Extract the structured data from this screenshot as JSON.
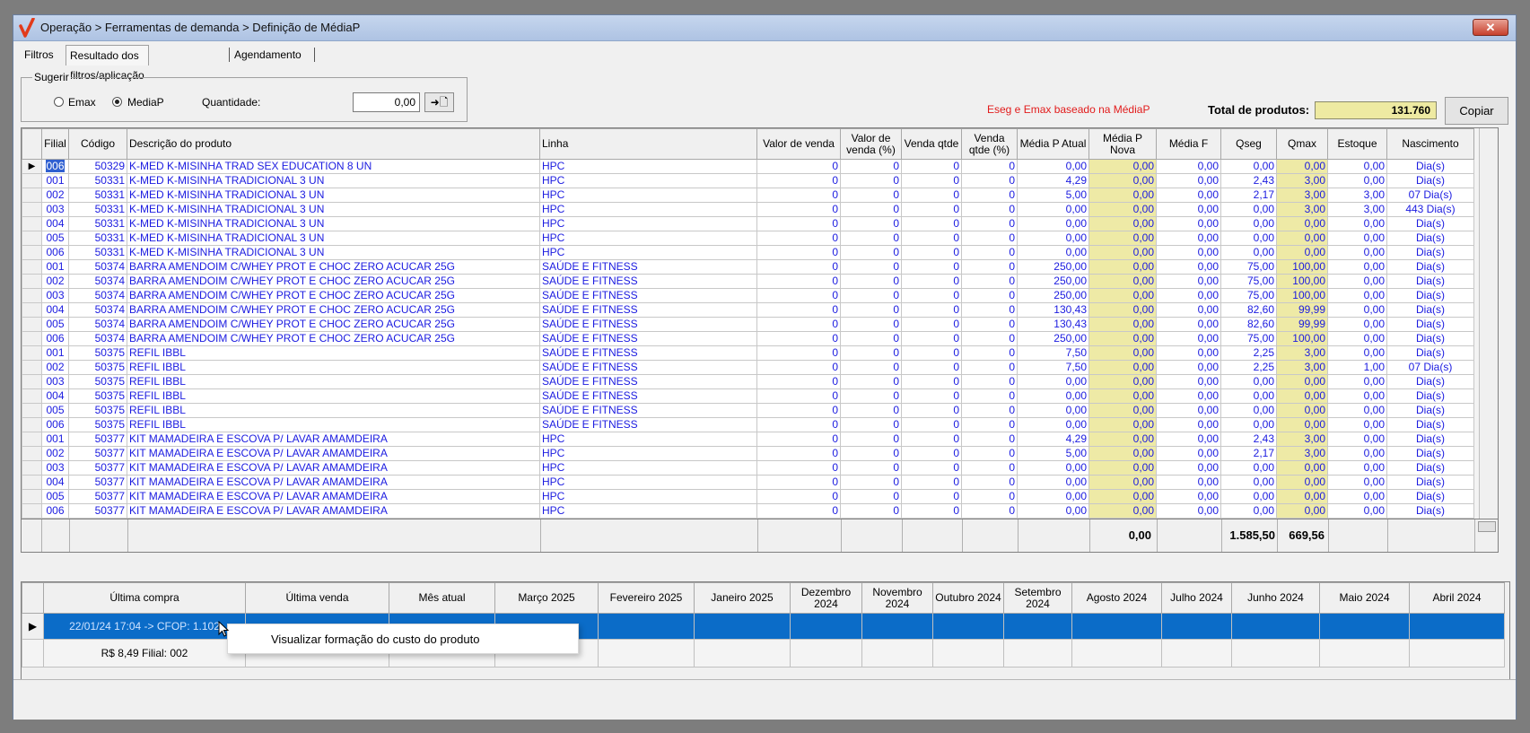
{
  "window": {
    "title": "Operação > Ferramentas de demanda > Definição de MédiaP",
    "close_label": "✕"
  },
  "tabs": [
    "Filtros",
    "Resultado dos filtros/aplicação",
    "Agendamento"
  ],
  "sugerir": {
    "title": "Sugerir",
    "emax_label": "Emax",
    "mediap_label": "MediaP",
    "selected": "MediaP",
    "quantidade_label": "Quantidade:",
    "quantidade_value": "0,00",
    "apply_icon": "➜🗋"
  },
  "red_note": "Eseg e Emax baseado na MédiaP",
  "total_label": "Total de produtos:",
  "total_value": "131.760",
  "copy_label": "Copiar",
  "grid": {
    "columns": [
      "Filial",
      "Código",
      "Descrição do produto",
      "Linha",
      "Valor de venda",
      "Valor de venda (%)",
      "Venda qtde",
      "Venda qtde (%)",
      "Média P Atual",
      "Média P Nova",
      "Média F",
      "Qseg",
      "Qmax",
      "Estoque",
      "Nascimento"
    ],
    "rows": [
      [
        "006",
        "50329",
        "K-MED K-MISINHA TRAD SEX EDUCATION 8 UN",
        "HPC",
        "0",
        "0",
        "0",
        "0",
        "0,00",
        "0,00",
        "0,00",
        "0,00",
        "0,00",
        "0,00",
        "Dia(s)"
      ],
      [
        "001",
        "50331",
        "K-MED K-MISINHA TRADICIONAL 3 UN",
        "HPC",
        "0",
        "0",
        "0",
        "0",
        "4,29",
        "0,00",
        "0,00",
        "2,43",
        "3,00",
        "0,00",
        "Dia(s)"
      ],
      [
        "002",
        "50331",
        "K-MED K-MISINHA TRADICIONAL 3 UN",
        "HPC",
        "0",
        "0",
        "0",
        "0",
        "5,00",
        "0,00",
        "0,00",
        "2,17",
        "3,00",
        "3,00",
        "07 Dia(s)"
      ],
      [
        "003",
        "50331",
        "K-MED K-MISINHA TRADICIONAL 3 UN",
        "HPC",
        "0",
        "0",
        "0",
        "0",
        "0,00",
        "0,00",
        "0,00",
        "0,00",
        "3,00",
        "3,00",
        "443 Dia(s)"
      ],
      [
        "004",
        "50331",
        "K-MED K-MISINHA TRADICIONAL 3 UN",
        "HPC",
        "0",
        "0",
        "0",
        "0",
        "0,00",
        "0,00",
        "0,00",
        "0,00",
        "0,00",
        "0,00",
        "Dia(s)"
      ],
      [
        "005",
        "50331",
        "K-MED K-MISINHA TRADICIONAL 3 UN",
        "HPC",
        "0",
        "0",
        "0",
        "0",
        "0,00",
        "0,00",
        "0,00",
        "0,00",
        "0,00",
        "0,00",
        "Dia(s)"
      ],
      [
        "006",
        "50331",
        "K-MED K-MISINHA TRADICIONAL 3 UN",
        "HPC",
        "0",
        "0",
        "0",
        "0",
        "0,00",
        "0,00",
        "0,00",
        "0,00",
        "0,00",
        "0,00",
        "Dia(s)"
      ],
      [
        "001",
        "50374",
        "BARRA AMENDOIM C/WHEY PROT E CHOC ZERO ACUCAR 25G",
        "SAÚDE E FITNESS",
        "0",
        "0",
        "0",
        "0",
        "250,00",
        "0,00",
        "0,00",
        "75,00",
        "100,00",
        "0,00",
        "Dia(s)"
      ],
      [
        "002",
        "50374",
        "BARRA AMENDOIM C/WHEY PROT E CHOC ZERO ACUCAR 25G",
        "SAÚDE E FITNESS",
        "0",
        "0",
        "0",
        "0",
        "250,00",
        "0,00",
        "0,00",
        "75,00",
        "100,00",
        "0,00",
        "Dia(s)"
      ],
      [
        "003",
        "50374",
        "BARRA AMENDOIM C/WHEY PROT E CHOC ZERO ACUCAR 25G",
        "SAÚDE E FITNESS",
        "0",
        "0",
        "0",
        "0",
        "250,00",
        "0,00",
        "0,00",
        "75,00",
        "100,00",
        "0,00",
        "Dia(s)"
      ],
      [
        "004",
        "50374",
        "BARRA AMENDOIM C/WHEY PROT E CHOC ZERO ACUCAR 25G",
        "SAÚDE E FITNESS",
        "0",
        "0",
        "0",
        "0",
        "130,43",
        "0,00",
        "0,00",
        "82,60",
        "99,99",
        "0,00",
        "Dia(s)"
      ],
      [
        "005",
        "50374",
        "BARRA AMENDOIM C/WHEY PROT E CHOC ZERO ACUCAR 25G",
        "SAÚDE E FITNESS",
        "0",
        "0",
        "0",
        "0",
        "130,43",
        "0,00",
        "0,00",
        "82,60",
        "99,99",
        "0,00",
        "Dia(s)"
      ],
      [
        "006",
        "50374",
        "BARRA AMENDOIM C/WHEY PROT E CHOC ZERO ACUCAR 25G",
        "SAÚDE E FITNESS",
        "0",
        "0",
        "0",
        "0",
        "250,00",
        "0,00",
        "0,00",
        "75,00",
        "100,00",
        "0,00",
        "Dia(s)"
      ],
      [
        "001",
        "50375",
        "REFIL IBBL",
        "SAÚDE E FITNESS",
        "0",
        "0",
        "0",
        "0",
        "7,50",
        "0,00",
        "0,00",
        "2,25",
        "3,00",
        "0,00",
        "Dia(s)"
      ],
      [
        "002",
        "50375",
        "REFIL IBBL",
        "SAÚDE E FITNESS",
        "0",
        "0",
        "0",
        "0",
        "7,50",
        "0,00",
        "0,00",
        "2,25",
        "3,00",
        "1,00",
        "07 Dia(s)"
      ],
      [
        "003",
        "50375",
        "REFIL IBBL",
        "SAÚDE E FITNESS",
        "0",
        "0",
        "0",
        "0",
        "0,00",
        "0,00",
        "0,00",
        "0,00",
        "0,00",
        "0,00",
        "Dia(s)"
      ],
      [
        "004",
        "50375",
        "REFIL IBBL",
        "SAÚDE E FITNESS",
        "0",
        "0",
        "0",
        "0",
        "0,00",
        "0,00",
        "0,00",
        "0,00",
        "0,00",
        "0,00",
        "Dia(s)"
      ],
      [
        "005",
        "50375",
        "REFIL IBBL",
        "SAÚDE E FITNESS",
        "0",
        "0",
        "0",
        "0",
        "0,00",
        "0,00",
        "0,00",
        "0,00",
        "0,00",
        "0,00",
        "Dia(s)"
      ],
      [
        "006",
        "50375",
        "REFIL IBBL",
        "SAÚDE E FITNESS",
        "0",
        "0",
        "0",
        "0",
        "0,00",
        "0,00",
        "0,00",
        "0,00",
        "0,00",
        "0,00",
        "Dia(s)"
      ],
      [
        "001",
        "50377",
        "KIT MAMADEIRA E ESCOVA P/ LAVAR AMAMDEIRA",
        "HPC",
        "0",
        "0",
        "0",
        "0",
        "4,29",
        "0,00",
        "0,00",
        "2,43",
        "3,00",
        "0,00",
        "Dia(s)"
      ],
      [
        "002",
        "50377",
        "KIT MAMADEIRA E ESCOVA P/ LAVAR AMAMDEIRA",
        "HPC",
        "0",
        "0",
        "0",
        "0",
        "5,00",
        "0,00",
        "0,00",
        "2,17",
        "3,00",
        "0,00",
        "Dia(s)"
      ],
      [
        "003",
        "50377",
        "KIT MAMADEIRA E ESCOVA P/ LAVAR AMAMDEIRA",
        "HPC",
        "0",
        "0",
        "0",
        "0",
        "0,00",
        "0,00",
        "0,00",
        "0,00",
        "0,00",
        "0,00",
        "Dia(s)"
      ],
      [
        "004",
        "50377",
        "KIT MAMADEIRA E ESCOVA P/ LAVAR AMAMDEIRA",
        "HPC",
        "0",
        "0",
        "0",
        "0",
        "0,00",
        "0,00",
        "0,00",
        "0,00",
        "0,00",
        "0,00",
        "Dia(s)"
      ],
      [
        "005",
        "50377",
        "KIT MAMADEIRA E ESCOVA P/ LAVAR AMAMDEIRA",
        "HPC",
        "0",
        "0",
        "0",
        "0",
        "0,00",
        "0,00",
        "0,00",
        "0,00",
        "0,00",
        "0,00",
        "Dia(s)"
      ],
      [
        "006",
        "50377",
        "KIT MAMADEIRA E ESCOVA P/ LAVAR AMAMDEIRA",
        "HPC",
        "0",
        "0",
        "0",
        "0",
        "0,00",
        "0,00",
        "0,00",
        "0,00",
        "0,00",
        "0,00",
        "Dia(s)"
      ]
    ],
    "totals": {
      "media_p_nova": "0,00",
      "qseg": "1.585,50",
      "qmax": "669,56"
    },
    "row_indicator": "▶"
  },
  "history": {
    "columns": [
      "Última compra",
      "Última venda",
      "Mês atual",
      "Março 2025",
      "Fevereiro 2025",
      "Janeiro 2025",
      "Dezembro 2024",
      "Novembro 2024",
      "Outubro 2024",
      "Setembro 2024",
      "Agosto 2024",
      "Julho 2024",
      "Junho 2024",
      "Maio 2024",
      "Abril 2024"
    ],
    "row1_first": "22/01/24 17:04 -> CFOP: 1.102",
    "row2_first": "R$ 8,49 Filial: 002"
  },
  "context_menu": {
    "item": "Visualizar formação do custo do produto"
  }
}
